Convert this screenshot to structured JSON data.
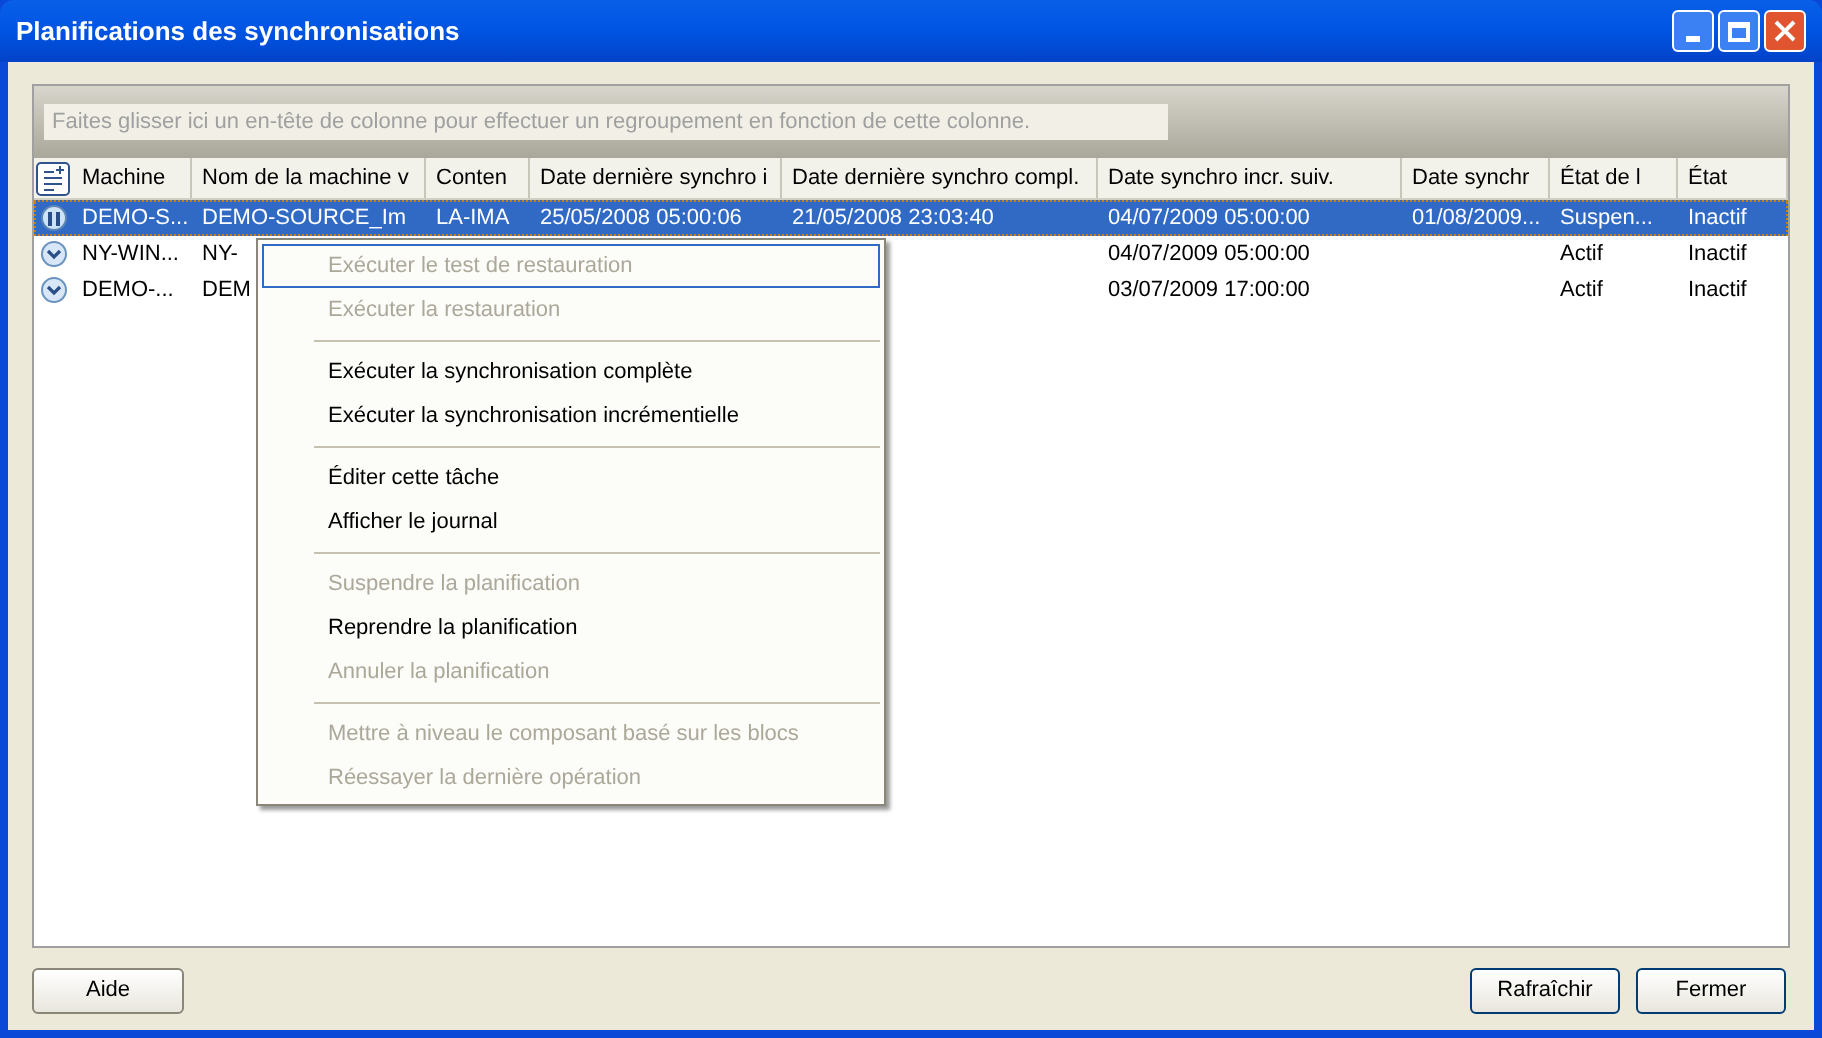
{
  "window": {
    "title": "Planifications des synchronisations"
  },
  "group_hint": "Faites glisser ici un en-tête de colonne pour effectuer un regroupement en fonction de cette colonne.",
  "table": {
    "columns": [
      "Machine",
      "Nom de la machine v",
      "Conten",
      "Date dernière synchro i",
      "Date dernière synchro compl.",
      "Date synchro incr. suiv.",
      "Date synchr",
      "État de l",
      "État"
    ],
    "rows": [
      {
        "selected": true,
        "kind": "paused",
        "cells": [
          "DEMO-S...",
          "DEMO-SOURCE_Im",
          "LA-IMA",
          "25/05/2008 05:00:06",
          "21/05/2008 23:03:40",
          "04/07/2009 05:00:00",
          "01/08/2009...",
          "Suspen...",
          "Inactif"
        ]
      },
      {
        "selected": false,
        "kind": "scheduled",
        "cells": [
          "NY-WIN...",
          "NY-",
          null,
          null,
          null,
          "04/07/2009 05:00:00",
          null,
          "Actif",
          "Inactif"
        ]
      },
      {
        "selected": false,
        "kind": "scheduled",
        "cells": [
          "DEMO-...",
          "DEM",
          null,
          null,
          null,
          "03/07/2009 17:00:00",
          null,
          "Actif",
          "Inactif"
        ]
      }
    ]
  },
  "context_menu": [
    {
      "kind": "item",
      "label": "Exécuter le test de restauration",
      "disabled": true,
      "selected": true
    },
    {
      "kind": "item",
      "label": "Exécuter la restauration",
      "disabled": true,
      "selected": false
    },
    {
      "kind": "separator"
    },
    {
      "kind": "item",
      "label": "Exécuter la synchronisation complète",
      "disabled": false,
      "selected": false
    },
    {
      "kind": "item",
      "label": "Exécuter la synchronisation incrémentielle",
      "disabled": false,
      "selected": false
    },
    {
      "kind": "separator"
    },
    {
      "kind": "item",
      "label": "Éditer cette tâche",
      "disabled": false,
      "selected": false
    },
    {
      "kind": "item",
      "label": "Afficher le journal",
      "disabled": false,
      "selected": false
    },
    {
      "kind": "separator"
    },
    {
      "kind": "item",
      "label": "Suspendre la planification",
      "disabled": true,
      "selected": false
    },
    {
      "kind": "item",
      "label": "Reprendre la planification",
      "disabled": false,
      "selected": false
    },
    {
      "kind": "item",
      "label": "Annuler la planification",
      "disabled": true,
      "selected": false
    },
    {
      "kind": "separator"
    },
    {
      "kind": "item",
      "label": "Mettre à niveau le composant basé sur les blocs",
      "disabled": true,
      "selected": false
    },
    {
      "kind": "item",
      "label": "Réessayer la dernière opération",
      "disabled": true,
      "selected": false
    }
  ],
  "buttons_left": [
    "Aide"
  ],
  "buttons_right": [
    "Rafraîchir",
    "Fermer"
  ]
}
